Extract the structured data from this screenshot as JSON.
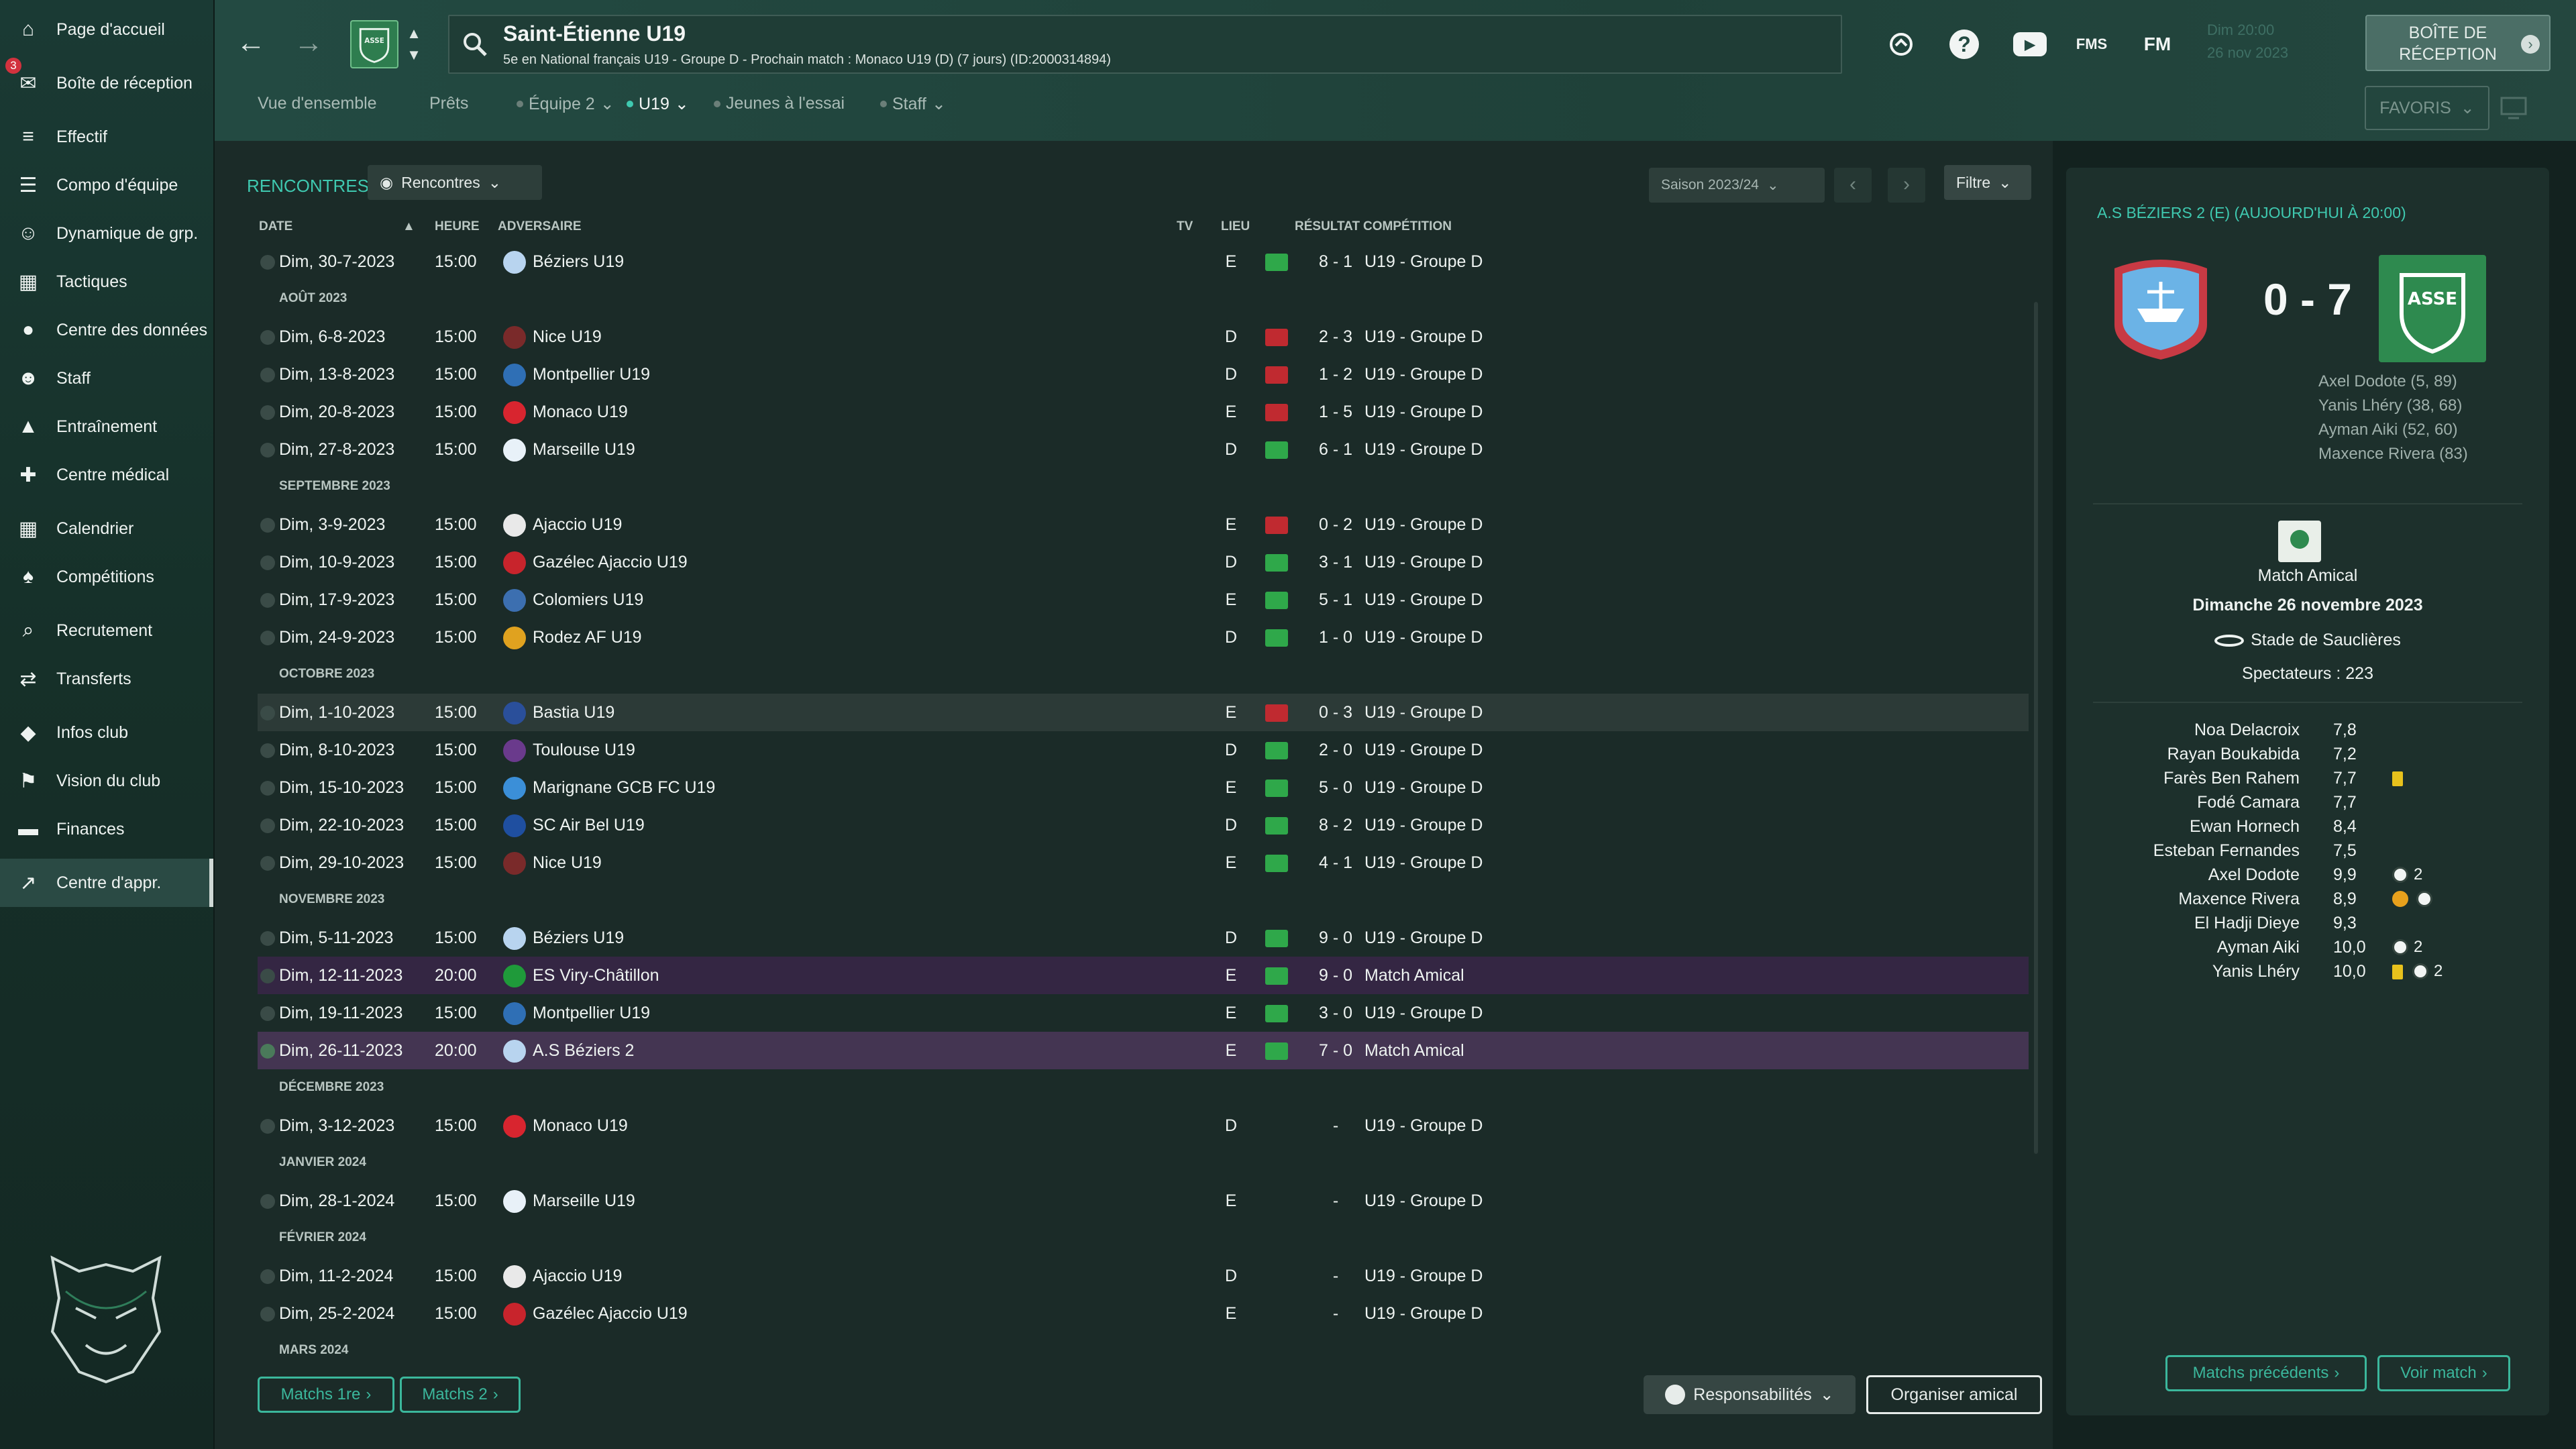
{
  "sidebar": {
    "items": [
      {
        "label": "Page d'accueil",
        "icon": "home-icon"
      },
      {
        "label": "Boîte de réception",
        "icon": "inbox-icon",
        "badge": "3"
      },
      {
        "label": "Effectif",
        "icon": "squad-icon"
      },
      {
        "label": "Compo d'équipe",
        "icon": "clipboard-icon"
      },
      {
        "label": "Dynamique de grp.",
        "icon": "group-icon"
      },
      {
        "label": "Tactiques",
        "icon": "tactics-icon"
      },
      {
        "label": "Centre des données",
        "icon": "data-icon"
      },
      {
        "label": "Staff",
        "icon": "staff-icon"
      },
      {
        "label": "Entraînement",
        "icon": "training-icon"
      },
      {
        "label": "Centre médical",
        "icon": "medical-icon"
      },
      {
        "label": "Calendrier",
        "icon": "calendar-icon"
      },
      {
        "label": "Compétitions",
        "icon": "trophy-icon"
      },
      {
        "label": "Recrutement",
        "icon": "scouting-icon"
      },
      {
        "label": "Transferts",
        "icon": "transfer-icon"
      },
      {
        "label": "Infos club",
        "icon": "shield-icon"
      },
      {
        "label": "Vision du club",
        "icon": "vision-icon"
      },
      {
        "label": "Finances",
        "icon": "money-icon"
      },
      {
        "label": "Centre d'appr.",
        "icon": "academy-icon"
      }
    ]
  },
  "header": {
    "title": "Saint-Étienne U19",
    "subtitle": "5e en National français U19 - Groupe D - Prochain match : Monaco U19 (D) (7 jours) (ID:2000314894)",
    "date_line1": "Dim 20:00",
    "date_line2": "26 nov 2023",
    "inbox_button": "BOÎTE DE RÉCEPTION",
    "fms_label": "FMS",
    "fm_label": "FM",
    "favourites_label": "FAVORIS"
  },
  "tabs": [
    {
      "label": "Vue d'ensemble",
      "chevron": false,
      "dot": false
    },
    {
      "label": "Prêts",
      "chevron": false,
      "dot": false
    },
    {
      "label": "Équipe 2",
      "chevron": true,
      "dot": true
    },
    {
      "label": "U19",
      "chevron": true,
      "dot": true
    },
    {
      "label": "Jeunes à l'essai",
      "chevron": false,
      "dot": true
    },
    {
      "label": "Staff",
      "chevron": true,
      "dot": true
    }
  ],
  "fixtures": {
    "section_label": "RENCONTRES",
    "view_dropdown": "Rencontres",
    "season_dropdown": "Saison 2023/24",
    "filter_label": "Filtre",
    "columns": {
      "date": "DATE",
      "time": "HEURE",
      "opponent": "ADVERSAIRE",
      "tv": "TV",
      "venue": "LIEU",
      "result": "RÉSULTAT",
      "competition": "COMPÉTITION"
    },
    "rows": [
      {
        "kind": "match",
        "date": "Dim, 30-7-2023",
        "time": "15:00",
        "opponent": "Béziers U19",
        "crest": "#b8d4ef",
        "venue": "E",
        "outcome": "w",
        "result": "8 - 1",
        "competition": "U19 - Groupe D"
      },
      {
        "kind": "month",
        "label": "AOÛT 2023"
      },
      {
        "kind": "match",
        "date": "Dim, 6-8-2023",
        "time": "15:00",
        "opponent": "Nice U19",
        "crest": "#7a2a2a",
        "venue": "D",
        "outcome": "l",
        "result": "2 - 3",
        "competition": "U19 - Groupe D"
      },
      {
        "kind": "match",
        "date": "Dim, 13-8-2023",
        "time": "15:00",
        "opponent": "Montpellier U19",
        "crest": "#2f6fb5",
        "venue": "D",
        "outcome": "l",
        "result": "1 - 2",
        "competition": "U19 - Groupe D"
      },
      {
        "kind": "match",
        "date": "Dim, 20-8-2023",
        "time": "15:00",
        "opponent": "Monaco U19",
        "crest": "#d8252f",
        "venue": "E",
        "outcome": "l",
        "result": "1 - 5",
        "competition": "U19 - Groupe D"
      },
      {
        "kind": "match",
        "date": "Dim, 27-8-2023",
        "time": "15:00",
        "opponent": "Marseille U19",
        "crest": "#e8f1f8",
        "venue": "D",
        "outcome": "w",
        "result": "6 - 1",
        "competition": "U19 - Groupe D"
      },
      {
        "kind": "month",
        "label": "SEPTEMBRE 2023"
      },
      {
        "kind": "match",
        "date": "Dim, 3-9-2023",
        "time": "15:00",
        "opponent": "Ajaccio U19",
        "crest": "#e9e9e9",
        "venue": "E",
        "outcome": "l",
        "result": "0 - 2",
        "competition": "U19 - Groupe D"
      },
      {
        "kind": "match",
        "date": "Dim, 10-9-2023",
        "time": "15:00",
        "opponent": "Gazélec Ajaccio U19",
        "crest": "#c8242c",
        "venue": "D",
        "outcome": "w",
        "result": "3 - 1",
        "competition": "U19 - Groupe D"
      },
      {
        "kind": "match",
        "date": "Dim, 17-9-2023",
        "time": "15:00",
        "opponent": "Colomiers U19",
        "crest": "#3c6fb0",
        "venue": "E",
        "outcome": "w",
        "result": "5 - 1",
        "competition": "U19 - Groupe D"
      },
      {
        "kind": "match",
        "date": "Dim, 24-9-2023",
        "time": "15:00",
        "opponent": "Rodez AF U19",
        "crest": "#e0a21f",
        "venue": "D",
        "outcome": "w",
        "result": "1 - 0",
        "competition": "U19 - Groupe D"
      },
      {
        "kind": "month",
        "label": "OCTOBRE 2023"
      },
      {
        "kind": "match",
        "date": "Dim, 1-10-2023",
        "time": "15:00",
        "opponent": "Bastia U19",
        "crest": "#2a4f9a",
        "venue": "E",
        "outcome": "l",
        "result": "0 - 3",
        "competition": "U19 - Groupe D",
        "highlight": true
      },
      {
        "kind": "match",
        "date": "Dim, 8-10-2023",
        "time": "15:00",
        "opponent": "Toulouse U19",
        "crest": "#6a3a8c",
        "venue": "D",
        "outcome": "w",
        "result": "2 - 0",
        "competition": "U19 - Groupe D"
      },
      {
        "kind": "match",
        "date": "Dim, 15-10-2023",
        "time": "15:00",
        "opponent": "Marignane GCB FC U19",
        "crest": "#3b8fd8",
        "venue": "E",
        "outcome": "w",
        "result": "5 - 0",
        "competition": "U19 - Groupe D"
      },
      {
        "kind": "match",
        "date": "Dim, 22-10-2023",
        "time": "15:00",
        "opponent": "SC Air Bel U19",
        "crest": "#1f4fa0",
        "venue": "D",
        "outcome": "w",
        "result": "8 - 2",
        "competition": "U19 - Groupe D"
      },
      {
        "kind": "match",
        "date": "Dim, 29-10-2023",
        "time": "15:00",
        "opponent": "Nice U19",
        "crest": "#7a2a2a",
        "venue": "E",
        "outcome": "w",
        "result": "4 - 1",
        "competition": "U19 - Groupe D"
      },
      {
        "kind": "month",
        "label": "NOVEMBRE 2023"
      },
      {
        "kind": "match",
        "date": "Dim, 5-11-2023",
        "time": "15:00",
        "opponent": "Béziers U19",
        "crest": "#b8d4ef",
        "venue": "D",
        "outcome": "w",
        "result": "9 - 0",
        "competition": "U19 - Groupe D"
      },
      {
        "kind": "match",
        "date": "Dim, 12-11-2023",
        "time": "20:00",
        "opponent": "ES Viry-Châtillon",
        "crest": "#1f9a3a",
        "venue": "E",
        "outcome": "w",
        "result": "9 - 0",
        "competition": "Match Amical",
        "event": true
      },
      {
        "kind": "match",
        "date": "Dim, 19-11-2023",
        "time": "15:00",
        "opponent": "Montpellier U19",
        "crest": "#2f6fb5",
        "venue": "E",
        "outcome": "w",
        "result": "3 - 0",
        "competition": "U19 - Groupe D"
      },
      {
        "kind": "match",
        "date": "Dim, 26-11-2023",
        "time": "20:00",
        "opponent": "A.S Béziers 2",
        "crest": "#b8d4ef",
        "venue": "E",
        "outcome": "w",
        "result": "7 - 0",
        "competition": "Match Amical",
        "selected": true
      },
      {
        "kind": "month",
        "label": "DÉCEMBRE 2023"
      },
      {
        "kind": "match",
        "date": "Dim, 3-12-2023",
        "time": "15:00",
        "opponent": "Monaco U19",
        "crest": "#d8252f",
        "venue": "D",
        "outcome": "",
        "result": "-",
        "competition": "U19 - Groupe D"
      },
      {
        "kind": "month",
        "label": "JANVIER 2024"
      },
      {
        "kind": "match",
        "date": "Dim, 28-1-2024",
        "time": "15:00",
        "opponent": "Marseille U19",
        "crest": "#e8f1f8",
        "venue": "E",
        "outcome": "",
        "result": "-",
        "competition": "U19 - Groupe D"
      },
      {
        "kind": "month",
        "label": "FÉVRIER 2024"
      },
      {
        "kind": "match",
        "date": "Dim, 11-2-2024",
        "time": "15:00",
        "opponent": "Ajaccio U19",
        "crest": "#e9e9e9",
        "venue": "D",
        "outcome": "",
        "result": "-",
        "competition": "U19 - Groupe D"
      },
      {
        "kind": "match",
        "date": "Dim, 25-2-2024",
        "time": "15:00",
        "opponent": "Gazélec Ajaccio U19",
        "crest": "#c8242c",
        "venue": "E",
        "outcome": "",
        "result": "-",
        "competition": "U19 - Groupe D"
      },
      {
        "kind": "month",
        "label": "MARS 2024"
      }
    ],
    "buttons": {
      "matches_first": "Matchs 1re",
      "matches_second": "Matchs 2",
      "responsibilities": "Responsabilités",
      "arrange_friendly": "Organiser amical"
    }
  },
  "match_panel": {
    "title": "A.S BÉZIERS 2 (E) (AUJOURD'HUI À 20:00)",
    "score": "0 - 7",
    "scorers": [
      "Axel Dodote (5, 89)",
      "Yanis Lhéry (38, 68)",
      "Ayman Aiki (52, 60)",
      "Maxence Rivera (83)"
    ],
    "competition": "Match Amical",
    "date": "Dimanche 26 novembre 2023",
    "stadium": "Stade de Sauclières",
    "attendance": "Spectateurs : 223",
    "players": [
      {
        "name": "Noa Delacroix",
        "rating": "7,8"
      },
      {
        "name": "Rayan Boukabida",
        "rating": "7,2"
      },
      {
        "name": "Farès Ben Rahem",
        "rating": "7,7",
        "yellow": true
      },
      {
        "name": "Fodé Camara",
        "rating": "7,7"
      },
      {
        "name": "Ewan Hornech",
        "rating": "8,4"
      },
      {
        "name": "Esteban Fernandes",
        "rating": "7,5"
      },
      {
        "name": "Axel Dodote",
        "rating": "9,9",
        "goals": "2"
      },
      {
        "name": "Maxence Rivera",
        "rating": "8,9",
        "assist": true,
        "goal": true
      },
      {
        "name": "El Hadji Dieye",
        "rating": "9,3"
      },
      {
        "name": "Ayman Aiki",
        "rating": "10,0",
        "goals": "2"
      },
      {
        "name": "Yanis Lhéry",
        "rating": "10,0",
        "yellow": true,
        "goals": "2"
      }
    ],
    "buttons": {
      "previous_matches": "Matchs précédents",
      "view_match": "Voir match"
    }
  },
  "colors": {
    "accent": "#3fc9b0",
    "win": "#2fa84a",
    "loss": "#c02a30",
    "yellow_card": "#e8c21c"
  }
}
